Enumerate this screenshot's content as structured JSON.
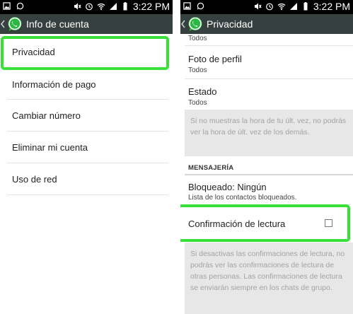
{
  "status_bar": {
    "time": "3:22 PM",
    "left_icons": [
      "image-notification-icon",
      "whatsapp-notification-icon"
    ],
    "right_icons": [
      "mute-icon",
      "alarm-icon",
      "wifi-icon",
      "signal-icon",
      "battery-icon"
    ]
  },
  "left": {
    "app_bar": {
      "title": "Info de cuenta"
    },
    "items": [
      {
        "label": "Privacidad"
      },
      {
        "label": "Información de pago"
      },
      {
        "label": "Cambiar número"
      },
      {
        "label": "Eliminar mi cuenta"
      },
      {
        "label": "Uso de red"
      }
    ]
  },
  "right": {
    "app_bar": {
      "title": "Privacidad"
    },
    "partial_top_sub": "Todos",
    "profile_photo": {
      "title": "Foto de perfil",
      "value": "Todos"
    },
    "status": {
      "title": "Estado",
      "value": "Todos"
    },
    "last_seen_note": "Si no muestras la hora de tu últ. vez, no podrás ver la hora de últ. vez de los demás.",
    "section_header": "MENSAJERÍA",
    "blocked": {
      "title": "Bloqueado: Ningún",
      "subtitle": "Lista de los contactos bloqueados."
    },
    "read_receipts": {
      "title": "Confirmación de lectura",
      "checked": false
    },
    "read_receipts_note": "Si desactivas las confirmaciones de lectura, no podrás ver las confirmaciones de lectura de otras personas. Las confirmaciones de lectura se enviarán siempre en los chats de grupo."
  },
  "colors": {
    "app_bar": "#36403f",
    "status_bar": "#000000",
    "highlight": "#39e03a",
    "info_box": "#e7e7e7",
    "whatsapp_green": "#2bb741"
  }
}
